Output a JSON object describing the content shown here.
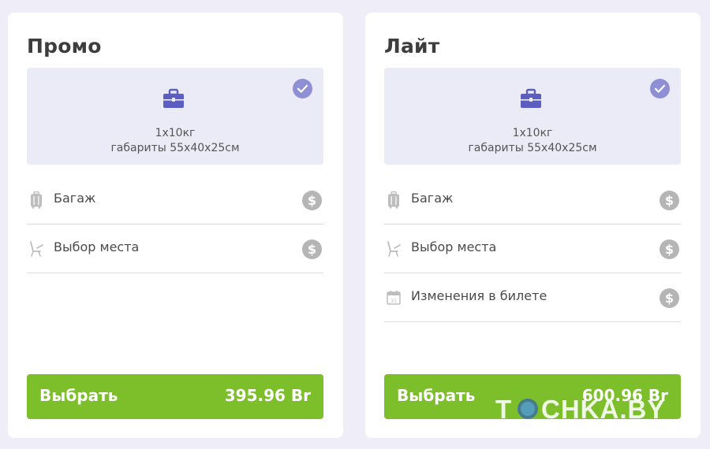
{
  "cards": [
    {
      "title": "Промо",
      "baggage": {
        "line1": "1x10кг",
        "line2": "габариты 55x40x25см"
      },
      "features": [
        {
          "label": "Багаж",
          "icon": "suitcase-icon"
        },
        {
          "label": "Выбор места",
          "icon": "seat-icon"
        }
      ],
      "button": {
        "label": "Выбрать",
        "price": "395.96 Br"
      }
    },
    {
      "title": "Лайт",
      "baggage": {
        "line1": "1x10кг",
        "line2": "габариты 55x40x25см"
      },
      "features": [
        {
          "label": "Багаж",
          "icon": "suitcase-icon"
        },
        {
          "label": "Выбор места",
          "icon": "seat-icon"
        },
        {
          "label": "Изменения в билете",
          "icon": "calendar-icon"
        }
      ],
      "button": {
        "label": "Выбрать",
        "price": "600.96 Br"
      }
    }
  ],
  "watermark": "TOCHKA.BY",
  "colors": {
    "background": "#eeedf8",
    "baggage_box": "#ebebf8",
    "accent_purple": "#5b5ec0",
    "check_purple": "#8f8fd6",
    "button_green": "#7dbf2a",
    "dollar_gray": "#b5b5b5"
  }
}
